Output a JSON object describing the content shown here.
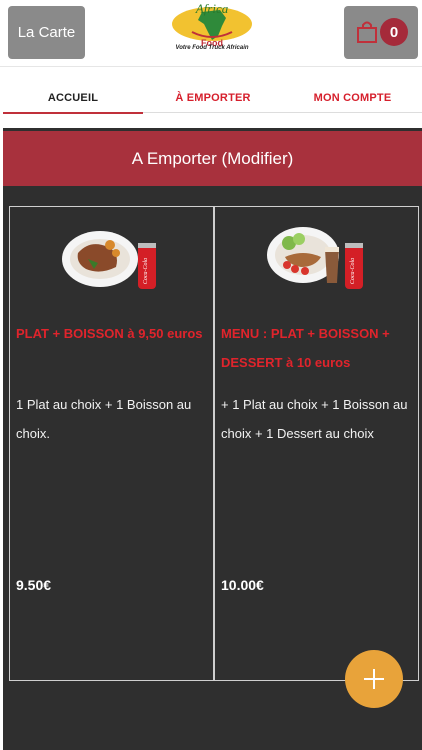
{
  "header": {
    "menu_button_label": "La Carte",
    "cart_count": "0",
    "logo_title": "Africa",
    "logo_word": "Food",
    "logo_tagline": "Votre Food Truck Africain"
  },
  "tabs": [
    {
      "label": "ACCUEIL",
      "active": true
    },
    {
      "label": "À EMPORTER",
      "active": false
    },
    {
      "label": "MON COMPTE",
      "active": false
    }
  ],
  "panel": {
    "title": "A Emporter (Modifier)"
  },
  "products": [
    {
      "name": "PLAT + BOISSON à 9,50 euros",
      "description": "1 Plat au choix  + 1 Boisson au choix.",
      "price": "9.50€",
      "drink_label": "Coca-Cola"
    },
    {
      "name": "MENU : PLAT + BOISSON + DESSERT à 10 euros",
      "description": "+ 1 Plat au choix  + 1 Boisson au choix  + 1 Dessert au choix",
      "price": "10.00€",
      "drink_label": "Coca-Cola"
    }
  ],
  "fab": {
    "icon": "plus-icon"
  },
  "colors": {
    "accent_red": "#a8313d",
    "text_red": "#e0242c",
    "fab_orange": "#e8a33a",
    "button_gray": "#8a8a8a",
    "panel_dark": "#2f2f2f"
  }
}
